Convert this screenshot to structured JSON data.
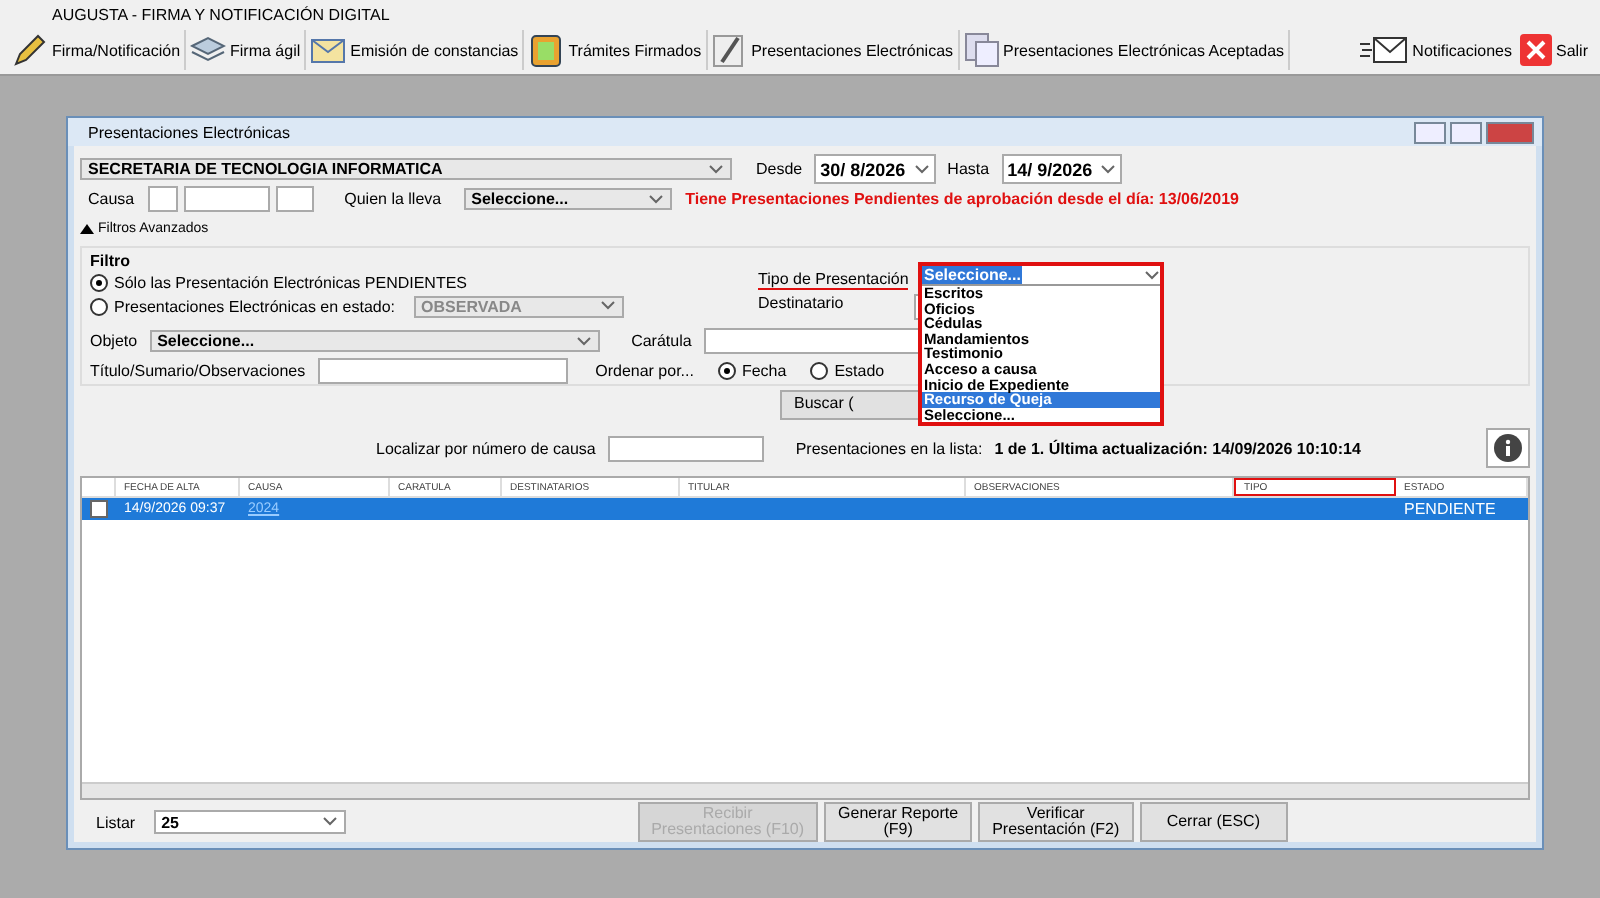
{
  "window": {
    "title": "AUGUSTA - FIRMA Y NOTIFICACIÓN DIGITAL"
  },
  "toolbar": [
    {
      "label": "Firma/Notificación"
    },
    {
      "label": "Firma ágil"
    },
    {
      "label": "Emisión de constancias"
    },
    {
      "label": "Trámites Firmados"
    },
    {
      "label": "Presentaciones Electrónicas"
    },
    {
      "label": "Presentaciones Electrónicas Aceptadas"
    },
    {
      "label": "Notificaciones"
    },
    {
      "label": "Salir"
    }
  ],
  "dialog": {
    "title": "Presentaciones Electrónicas",
    "secretaria": "SECRETARIA DE TECNOLOGIA INFORMATICA",
    "desde_label": "Desde",
    "desde": "30/ 8/2026",
    "hasta_label": "Hasta",
    "hasta": "14/ 9/2026",
    "causa_label": "Causa",
    "quien_label": "Quien la lleva",
    "quien_value": "Seleccione...",
    "warning": "Tiene Presentaciones Pendientes de aprobación desde el día: 13/06/2019",
    "advanced_toggle": "Filtros Avanzados",
    "filtro": {
      "title": "Filtro",
      "radios": [
        {
          "label": "Sólo las Presentación Electrónicas PENDIENTES",
          "selected": true
        },
        {
          "label": "Presentaciones Electrónicas en estado:",
          "selected": false
        }
      ],
      "estado_value": "OBSERVADA",
      "tipo_label": "Tipo de Presentación",
      "tipo_highlighted": true,
      "tipo_value": "Seleccione...",
      "tipo_options": [
        {
          "label": "Escritos",
          "selected": false
        },
        {
          "label": "Oficios",
          "selected": false
        },
        {
          "label": "Cédulas",
          "selected": false
        },
        {
          "label": "Mandamientos",
          "selected": false
        },
        {
          "label": "Testimonio",
          "selected": false
        },
        {
          "label": "Acceso a causa",
          "selected": false
        },
        {
          "label": "Inicio de Expediente",
          "selected": false
        },
        {
          "label": "Recurso de Queja",
          "selected": true
        },
        {
          "label": "Seleccione...",
          "selected": false
        }
      ],
      "destinatario_label": "Destinatario",
      "objeto_label": "Objeto",
      "objeto_value": "Seleccione...",
      "caratula_label": "Carátula",
      "titulo_label": "Título/Sumario/Observaciones",
      "ordenar_label": "Ordenar por...",
      "ordenar_options": [
        {
          "label": "Fecha",
          "selected": true
        },
        {
          "label": "Estado",
          "selected": false
        }
      ]
    },
    "buscar": "Buscar (",
    "localizar_label": "Localizar por número de causa",
    "list_info_label": "Presentaciones en la lista:",
    "list_info_value": "1 de 1. Última actualización: 14/09/2026 10:10:14",
    "table": {
      "columns": [
        {
          "label": "FECHA DE ALTA",
          "highlighted": false
        },
        {
          "label": "CAUSA",
          "highlighted": false
        },
        {
          "label": "CARATULA",
          "highlighted": false
        },
        {
          "label": "DESTINATARIOS",
          "highlighted": false
        },
        {
          "label": "TITULAR",
          "highlighted": false
        },
        {
          "label": "OBSERVACIONES",
          "highlighted": false
        },
        {
          "label": "TIPO",
          "highlighted": true
        },
        {
          "label": "ESTADO",
          "highlighted": false
        }
      ],
      "rows": [
        {
          "checked": false,
          "selected": true,
          "fecha": "14/9/2026 09:37",
          "causa": "2024",
          "estado": "PENDIENTE"
        }
      ]
    },
    "listar_label": "Listar",
    "listar_value": "25",
    "buttons": [
      {
        "label": "Recibir\nPresentaciones (F10)",
        "disabled": true
      },
      {
        "label": "Generar Reporte\n(F9)",
        "disabled": false
      },
      {
        "label": "Verificar\nPresentación (F2)",
        "disabled": false
      },
      {
        "label": "Cerrar (ESC)",
        "disabled": false
      }
    ]
  }
}
